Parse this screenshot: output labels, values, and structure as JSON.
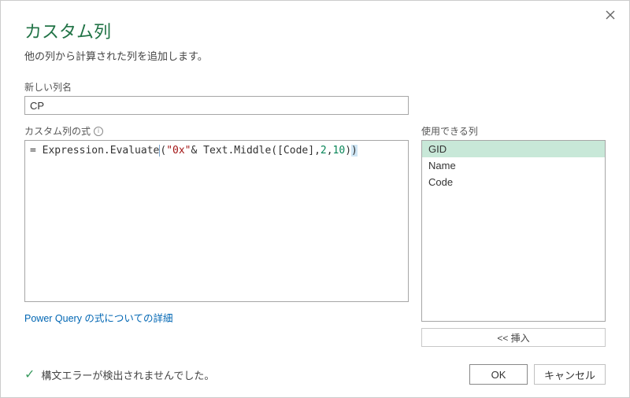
{
  "dialog": {
    "title": "カスタム列",
    "subtitle": "他の列から計算された列を追加します。",
    "new_col_label": "新しい列名",
    "new_col_value": "CP",
    "formula_label": "カスタム列の式",
    "formula_plain": "= Expression.Evaluate(\"0x\"& Text.Middle([Code],2,10))",
    "formula_tokens": {
      "eq": "= ",
      "ident1": "Expression.Evaluate",
      "lp1": "(",
      "str": "\"0x\"",
      "amp": "& ",
      "ident2": "Text.Middle",
      "lp2": "(",
      "col": "[Code]",
      "c1": ",",
      "n1": "2",
      "c2": ",",
      "n2": "10",
      "rp2": ")",
      "rp1": ")"
    },
    "avail_label": "使用できる列",
    "avail_items": [
      "GID",
      "Name",
      "Code"
    ],
    "insert_label": "<< 挿入",
    "help_link": "Power Query の式についての詳細",
    "status_text": "構文エラーが検出されませんでした。",
    "ok_label": "OK",
    "cancel_label": "キャンセル"
  }
}
